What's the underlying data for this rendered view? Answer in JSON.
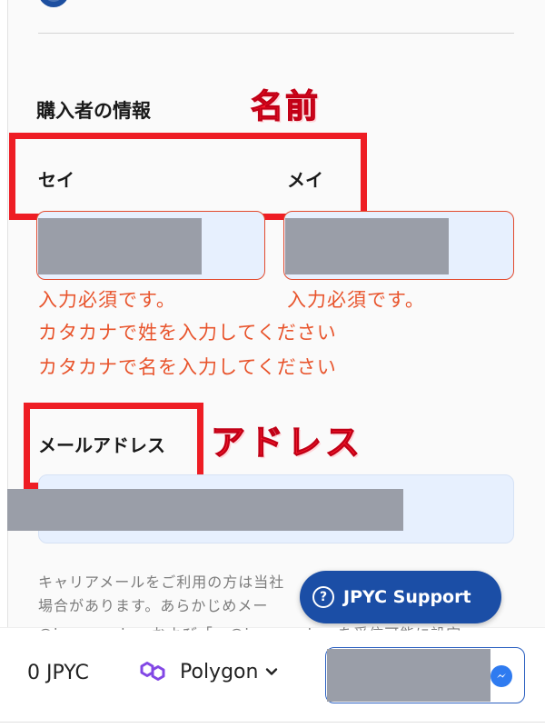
{
  "purchaser_section": {
    "title": "購入者の情報"
  },
  "annotations": {
    "name": "名前",
    "address": "アドレス",
    "box_color": "#ee1d24"
  },
  "fields": {
    "sei_label": "セイ",
    "mei_label": "メイ",
    "email_label": "メールアドレス"
  },
  "errors": {
    "sei_required": "入力必須です。",
    "mei_required": "入力必須です。",
    "sei_katakana": "カタカナで姓を入力してください",
    "mei_katakana": "カタカナで名を入力してください",
    "color": "#e8542c"
  },
  "note": {
    "line1": "キャリアメールをご利用の方は当社",
    "line2": "場合があります。あらかじめメー",
    "line3": "@jccm.co.jp」および「e-@jpyc.co.jp」を受信可能に設定"
  },
  "support": {
    "label": "JPYC Support",
    "icon": "question-circle-icon",
    "color": "#1b4ea6"
  },
  "footer": {
    "balance": "0 JPYC",
    "network": "Polygon",
    "network_icon": "polygon-logo-icon",
    "network_color": "#8247e5"
  }
}
